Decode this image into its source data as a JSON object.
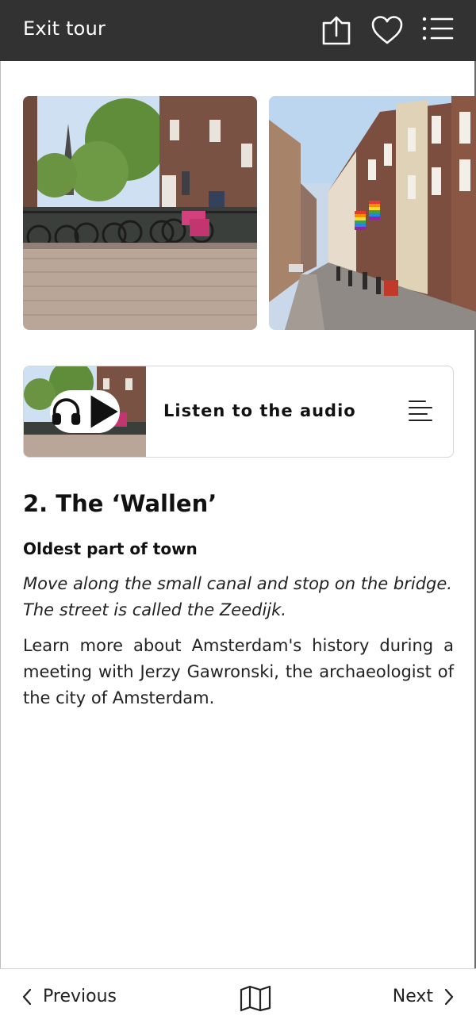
{
  "header": {
    "exit_label": "Exit tour",
    "icons": [
      "share-icon",
      "heart-icon",
      "list-menu-icon"
    ]
  },
  "gallery": {
    "photos": [
      "canal-bridge-bicycles-photo",
      "zeedijk-street-flags-photo"
    ]
  },
  "audio": {
    "label": "Listen to the audio",
    "icons": [
      "headphones-icon",
      "play-icon",
      "transcript-icon"
    ]
  },
  "stop": {
    "title": "2. The ‘Wallen’",
    "subtitle": "Oldest part of town",
    "instruction": "Move along the small canal and stop on the bridge. The street is called the Zeedijk.",
    "body": "Learn more about Amsterdam's history during a meeting with Jerzy Gawronski, the archaeologist of the city of Amsterdam."
  },
  "nav": {
    "previous_label": "Previous",
    "next_label": "Next",
    "icons": [
      "chevron-left-icon",
      "map-icon",
      "chevron-right-icon"
    ]
  },
  "colors": {
    "header_bg": "#323232",
    "header_text": "#ffffff",
    "card_border": "#d6d6d6",
    "text": "#111111"
  }
}
